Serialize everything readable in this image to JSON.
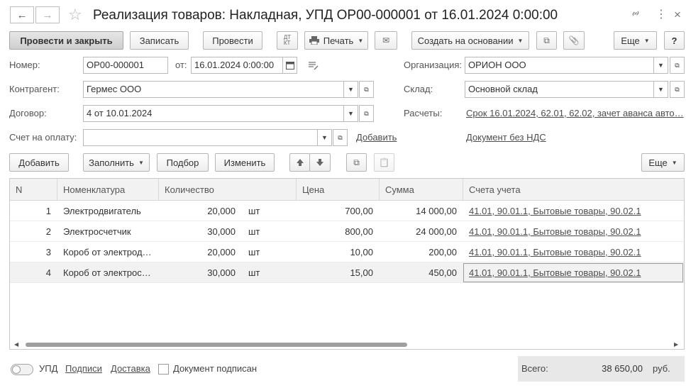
{
  "window": {
    "title": "Реализация товаров: Накладная, УПД ОР00-000001 от 16.01.2024 0:00:00",
    "back_icon": "←",
    "forward_icon": "→",
    "favorite_icon": "☆",
    "link_icon": "🔗",
    "more_icon": "⋮",
    "close_icon": "×"
  },
  "toolbar": {
    "post_close": "Провести и закрыть",
    "save": "Записать",
    "post": "Провести",
    "dtkt": "ДТ/КТ",
    "print": "Печать",
    "email_icon": "✉",
    "create_based": "Создать на основании",
    "structure_icon": "⧉",
    "attach_icon": "📎",
    "more": "Еще",
    "help": "?"
  },
  "form": {
    "number_label": "Номер:",
    "number_value": "ОР00-000001",
    "date_label": "от:",
    "date_value": "16.01.2024  0:00:00",
    "org_label": "Организация:",
    "org_value": "ОРИОН ООО",
    "counterparty_label": "Контрагент:",
    "counterparty_value": "Гермес ООО",
    "warehouse_label": "Склад:",
    "warehouse_value": "Основной склад",
    "contract_label": "Договор:",
    "contract_value": "4 от 10.01.2024",
    "settlements_label": "Расчеты:",
    "settlements_value": "Срок 16.01.2024, 62.01, 62.02, зачет аванса авто…",
    "invoice_label": "Счет на оплату:",
    "invoice_value": "",
    "add_link": "Добавить",
    "vat_link": "Документ без НДС"
  },
  "table_toolbar": {
    "add": "Добавить",
    "fill": "Заполнить",
    "pick": "Подбор",
    "change": "Изменить",
    "up_icon": "🡅",
    "down_icon": "🡇",
    "copy_icon": "⧉",
    "paste_icon": "📋",
    "more": "Еще"
  },
  "table": {
    "columns": [
      "N",
      "Номенклатура",
      "Количество",
      "Цена",
      "Сумма",
      "Счета учета"
    ],
    "rows": [
      {
        "n": "1",
        "item": "Электродвигатель",
        "qty": "20,000",
        "unit": "шт",
        "price": "700,00",
        "sum": "14 000,00",
        "accounts": "41.01, 90.01.1, Бытовые товары, 90.02.1"
      },
      {
        "n": "2",
        "item": "Электросчетчик",
        "qty": "30,000",
        "unit": "шт",
        "price": "800,00",
        "sum": "24 000,00",
        "accounts": "41.01, 90.01.1, Бытовые товары, 90.02.1"
      },
      {
        "n": "3",
        "item": "Короб от электрод…",
        "qty": "20,000",
        "unit": "шт",
        "price": "10,00",
        "sum": "200,00",
        "accounts": "41.01, 90.01.1, Бытовые товары, 90.02.1"
      },
      {
        "n": "4",
        "item": "Короб от электрос…",
        "qty": "30,000",
        "unit": "шт",
        "price": "15,00",
        "sum": "450,00",
        "accounts": "41.01, 90.01.1, Бытовые товары, 90.02.1"
      }
    ]
  },
  "footer": {
    "upd_label": "УПД",
    "signatures_link": "Подписи",
    "delivery_link": "Доставка",
    "signed_label": "Документ подписан",
    "total_label": "Всего:",
    "total_value": "38 650,00",
    "currency": "руб."
  }
}
